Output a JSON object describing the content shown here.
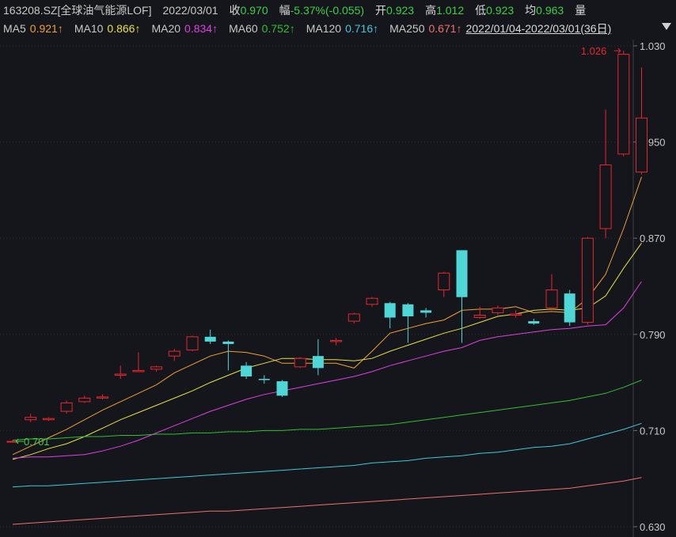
{
  "header": {
    "ticker": "163208.SZ[全球油气能源LOF]",
    "date": "2022/03/01",
    "close_label": "收",
    "close_value": "0.970",
    "change_label": "幅",
    "change_value": "-5.37%(-0.055)",
    "open_label": "开",
    "open_value": "0.923",
    "high_label": "高",
    "high_value": "1.012",
    "low_label": "低",
    "low_value": "0.923",
    "avg_label": "均",
    "avg_value": "0.963",
    "volume_label": "量"
  },
  "ma_legend": [
    {
      "label": "MA5",
      "value": "0.921↑",
      "color": "#f0a030"
    },
    {
      "label": "MA10",
      "value": "0.866↑",
      "color": "#e8e040"
    },
    {
      "label": "MA20",
      "value": "0.834↑",
      "color": "#e040e0"
    },
    {
      "label": "MA60",
      "value": "0.752↑",
      "color": "#30c030"
    },
    {
      "label": "MA120",
      "value": "0.716↑",
      "color": "#40c8d8"
    },
    {
      "label": "MA250",
      "value": "0.671↑",
      "color": "#f07070"
    }
  ],
  "range_text": "2022/01/04-2022/03/01(36日)",
  "colors": {
    "up": "#e8262e",
    "down": "#4fd6d6",
    "grid": "#2a2d33",
    "background": "#14161b"
  },
  "chart_data": {
    "type": "candlestick",
    "ylim": [
      0.625,
      1.035
    ],
    "y_ticks": [
      "0.630",
      "0.710",
      "0.790",
      "0.870",
      "0.950",
      "1.030"
    ],
    "annotations": {
      "max": "1.026",
      "min": "0.701"
    },
    "candles": [
      {
        "o": 0.701,
        "c": 0.701,
        "h": 0.702,
        "l": 0.7
      },
      {
        "o": 0.719,
        "c": 0.721,
        "h": 0.724,
        "l": 0.717
      },
      {
        "o": 0.719,
        "c": 0.72,
        "h": 0.721,
        "l": 0.718
      },
      {
        "o": 0.726,
        "c": 0.733,
        "h": 0.735,
        "l": 0.724
      },
      {
        "o": 0.734,
        "c": 0.737,
        "h": 0.739,
        "l": 0.733
      },
      {
        "o": 0.737,
        "c": 0.738,
        "h": 0.74,
        "l": 0.736
      },
      {
        "o": 0.756,
        "c": 0.757,
        "h": 0.764,
        "l": 0.753
      },
      {
        "o": 0.759,
        "c": 0.76,
        "h": 0.775,
        "l": 0.759
      },
      {
        "o": 0.761,
        "c": 0.763,
        "h": 0.764,
        "l": 0.759
      },
      {
        "o": 0.772,
        "c": 0.776,
        "h": 0.778,
        "l": 0.768
      },
      {
        "o": 0.777,
        "c": 0.788,
        "h": 0.789,
        "l": 0.776
      },
      {
        "o": 0.788,
        "c": 0.784,
        "h": 0.794,
        "l": 0.782
      },
      {
        "o": 0.784,
        "c": 0.782,
        "h": 0.785,
        "l": 0.76
      },
      {
        "o": 0.764,
        "c": 0.755,
        "h": 0.767,
        "l": 0.753
      },
      {
        "o": 0.753,
        "c": 0.752,
        "h": 0.756,
        "l": 0.749
      },
      {
        "o": 0.751,
        "c": 0.739,
        "h": 0.752,
        "l": 0.738
      },
      {
        "o": 0.763,
        "c": 0.77,
        "h": 0.771,
        "l": 0.762
      },
      {
        "o": 0.772,
        "c": 0.762,
        "h": 0.786,
        "l": 0.756
      },
      {
        "o": 0.784,
        "c": 0.785,
        "h": 0.787,
        "l": 0.781
      },
      {
        "o": 0.801,
        "c": 0.807,
        "h": 0.808,
        "l": 0.799
      },
      {
        "o": 0.815,
        "c": 0.82,
        "h": 0.821,
        "l": 0.813
      },
      {
        "o": 0.816,
        "c": 0.804,
        "h": 0.817,
        "l": 0.795
      },
      {
        "o": 0.815,
        "c": 0.805,
        "h": 0.816,
        "l": 0.783
      },
      {
        "o": 0.81,
        "c": 0.808,
        "h": 0.812,
        "l": 0.804
      },
      {
        "o": 0.827,
        "c": 0.841,
        "h": 0.842,
        "l": 0.821
      },
      {
        "o": 0.86,
        "c": 0.821,
        "h": 0.86,
        "l": 0.783
      },
      {
        "o": 0.804,
        "c": 0.806,
        "h": 0.813,
        "l": 0.803
      },
      {
        "o": 0.808,
        "c": 0.812,
        "h": 0.814,
        "l": 0.806
      },
      {
        "o": 0.806,
        "c": 0.807,
        "h": 0.81,
        "l": 0.804
      },
      {
        "o": 0.801,
        "c": 0.799,
        "h": 0.803,
        "l": 0.798
      },
      {
        "o": 0.812,
        "c": 0.827,
        "h": 0.84,
        "l": 0.81
      },
      {
        "o": 0.824,
        "c": 0.8,
        "h": 0.827,
        "l": 0.797
      },
      {
        "o": 0.8,
        "c": 0.87,
        "h": 0.871,
        "l": 0.798
      },
      {
        "o": 0.878,
        "c": 0.931,
        "h": 0.977,
        "l": 0.87
      },
      {
        "o": 0.94,
        "c": 1.023,
        "h": 1.026,
        "l": 0.938
      },
      {
        "o": 0.925,
        "c": 0.97,
        "h": 1.012,
        "l": 0.923
      }
    ],
    "ma_lines": [
      {
        "name": "MA5",
        "color": "#f0a030",
        "values": [
          0.69,
          0.697,
          0.704,
          0.711,
          0.719,
          0.727,
          0.734,
          0.741,
          0.748,
          0.758,
          0.765,
          0.772,
          0.776,
          0.775,
          0.772,
          0.766,
          0.766,
          0.766,
          0.766,
          0.762,
          0.776,
          0.791,
          0.795,
          0.799,
          0.802,
          0.81,
          0.811,
          0.811,
          0.813,
          0.808,
          0.809,
          0.808,
          0.82,
          0.84,
          0.878,
          0.921
        ]
      },
      {
        "name": "MA10",
        "color": "#e8e040",
        "values": [
          0.686,
          0.69,
          0.695,
          0.699,
          0.705,
          0.712,
          0.719,
          0.725,
          0.731,
          0.737,
          0.743,
          0.75,
          0.756,
          0.762,
          0.766,
          0.77,
          0.77,
          0.769,
          0.769,
          0.768,
          0.77,
          0.776,
          0.781,
          0.786,
          0.791,
          0.795,
          0.8,
          0.805,
          0.807,
          0.81,
          0.811,
          0.81,
          0.812,
          0.822,
          0.845,
          0.866
        ]
      },
      {
        "name": "MA20",
        "color": "#e040e0",
        "values": [
          0.687,
          0.688,
          0.688,
          0.689,
          0.69,
          0.693,
          0.697,
          0.702,
          0.708,
          0.714,
          0.72,
          0.726,
          0.731,
          0.736,
          0.74,
          0.743,
          0.746,
          0.749,
          0.752,
          0.755,
          0.759,
          0.764,
          0.768,
          0.772,
          0.776,
          0.779,
          0.785,
          0.788,
          0.79,
          0.792,
          0.794,
          0.795,
          0.797,
          0.798,
          0.812,
          0.834
        ]
      },
      {
        "name": "MA60",
        "color": "#30c030",
        "values": [
          0.702,
          0.703,
          0.703,
          0.704,
          0.705,
          0.705,
          0.706,
          0.706,
          0.707,
          0.707,
          0.708,
          0.708,
          0.709,
          0.709,
          0.71,
          0.71,
          0.711,
          0.711,
          0.712,
          0.713,
          0.714,
          0.715,
          0.717,
          0.719,
          0.721,
          0.723,
          0.725,
          0.727,
          0.729,
          0.731,
          0.733,
          0.735,
          0.738,
          0.741,
          0.746,
          0.752
        ]
      },
      {
        "name": "MA120",
        "color": "#40c8d8",
        "values": [
          0.663,
          0.664,
          0.664,
          0.665,
          0.666,
          0.667,
          0.668,
          0.669,
          0.67,
          0.671,
          0.672,
          0.673,
          0.674,
          0.675,
          0.676,
          0.677,
          0.678,
          0.679,
          0.68,
          0.681,
          0.683,
          0.684,
          0.685,
          0.687,
          0.688,
          0.689,
          0.691,
          0.692,
          0.694,
          0.696,
          0.697,
          0.699,
          0.703,
          0.707,
          0.711,
          0.716
        ]
      },
      {
        "name": "MA250",
        "color": "#f07070",
        "values": [
          0.632,
          0.633,
          0.634,
          0.635,
          0.636,
          0.637,
          0.638,
          0.639,
          0.64,
          0.641,
          0.642,
          0.643,
          0.643,
          0.644,
          0.645,
          0.646,
          0.647,
          0.648,
          0.649,
          0.65,
          0.651,
          0.652,
          0.653,
          0.654,
          0.655,
          0.656,
          0.657,
          0.658,
          0.659,
          0.66,
          0.661,
          0.662,
          0.664,
          0.666,
          0.668,
          0.671
        ]
      }
    ]
  }
}
